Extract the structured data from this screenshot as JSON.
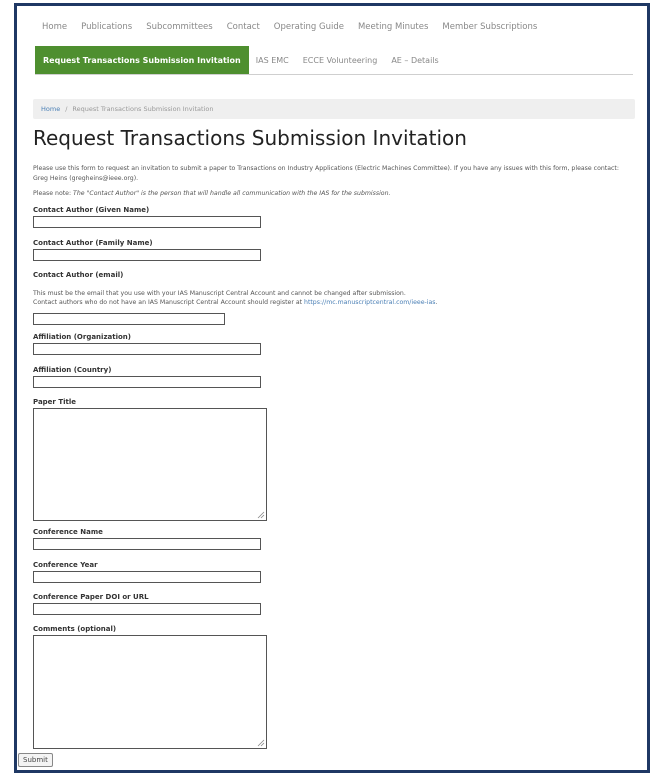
{
  "top_nav": [
    "Home",
    "Publications",
    "Subcommittees",
    "Contact",
    "Operating Guide",
    "Meeting Minutes",
    "Member Subscriptions"
  ],
  "sub_nav": [
    "Request Transactions Submission Invitation",
    "IAS EMC",
    "ECCE Volunteering",
    "AE – Details"
  ],
  "breadcrumb": {
    "home": "Home",
    "separator": "/",
    "current": "Request Transactions Submission Invitation"
  },
  "page_title": "Request Transactions Submission Invitation",
  "intro_text": "Please use this form to request an invitation to submit a paper to Transactions on Industry Applications (Electric Machines Committee). If you have any issues with this form, please contact: Greg Heins (gregheins@ieee.org).",
  "note_prefix": "Please note: ",
  "note_text": "The \"Contact Author\" is the person that will handle all communication with the IAS for the submission.",
  "email_help_line1": "This must be the email that you use with your IAS Manuscript Central Account and cannot be changed after submission.",
  "email_help_line2_prefix": "Contact authors who do not have an IAS Manuscript Central Account should register at ",
  "email_help_link": "https://mc.manuscriptcentral.com/ieee-ias",
  "email_help_suffix": ".",
  "fields": {
    "given_name": {
      "label": "Contact Author (Given Name)",
      "value": ""
    },
    "family_name": {
      "label": "Contact Author (Family Name)",
      "value": ""
    },
    "email": {
      "label": "Contact Author (email)",
      "value": ""
    },
    "organization": {
      "label": "Affiliation (Organization)",
      "value": ""
    },
    "country": {
      "label": "Affiliation (Country)",
      "value": ""
    },
    "paper_title": {
      "label": "Paper Title",
      "value": ""
    },
    "conference_name": {
      "label": "Conference Name",
      "value": ""
    },
    "conference_year": {
      "label": "Conference Year",
      "value": ""
    },
    "doi": {
      "label": "Conference Paper DOI or URL",
      "value": ""
    },
    "comments": {
      "label": "Comments (optional)",
      "value": ""
    }
  },
  "submit_label": "Submit",
  "colors": {
    "frame": "#1f3864",
    "active_tab": "#4e8f2f",
    "link": "#4a7fb5"
  }
}
